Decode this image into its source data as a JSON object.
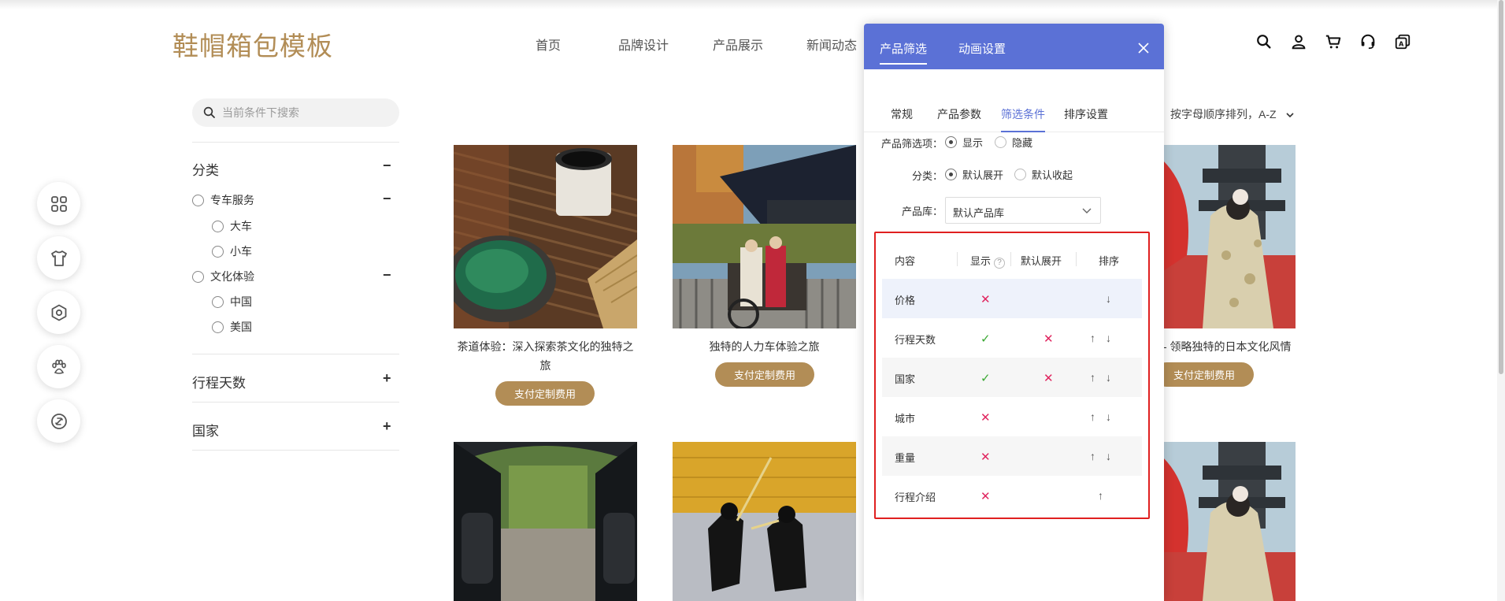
{
  "site": {
    "logo": "鞋帽箱包模板"
  },
  "nav": [
    "首页",
    "品牌设计",
    "产品展示",
    "新闻动态"
  ],
  "header_icons": [
    "search-icon",
    "user-icon",
    "cart-icon",
    "headset-icon",
    "translate-icon"
  ],
  "float_icons": [
    "apps-icon",
    "tshirt-icon",
    "settings-icon",
    "paw-icon",
    "link-icon"
  ],
  "sidebar": {
    "search_placeholder": "当前条件下搜索",
    "category": {
      "title": "分类",
      "toggle": "−",
      "groups": [
        {
          "label": "专车服务",
          "toggle": "−",
          "items": [
            "大车",
            "小车"
          ]
        },
        {
          "label": "文化体验",
          "toggle": "−",
          "items": [
            "中国",
            "美国"
          ]
        }
      ]
    },
    "sections": [
      {
        "title": "行程天数",
        "toggle": "+"
      },
      {
        "title": "国家",
        "toggle": "+"
      }
    ]
  },
  "sort": {
    "label": "按字母顺序排列，A-Z"
  },
  "products": [
    {
      "name_line1": "茶道体验：深入探索茶文化的独特之",
      "name_line2": "旅",
      "button": "支付定制费用"
    },
    {
      "name_line1": "独特的人力车体验之旅",
      "name_line2": "",
      "button": "支付定制费用"
    },
    {
      "name_line1": "- 领略独特的日本文化风情",
      "name_line2": "",
      "button": "支付定制费用"
    }
  ],
  "panel": {
    "tabs": [
      "产品筛选",
      "动画设置"
    ],
    "subtabs": [
      "常规",
      "产品参数",
      "筛选条件",
      "排序设置"
    ],
    "active_subtab": "筛选条件",
    "options": {
      "filter_label": "产品筛选项：",
      "filter_show": "显示",
      "filter_hide": "隐藏",
      "category_label": "分类：",
      "category_expand": "默认展开",
      "category_collapse": "默认收起",
      "library_label": "产品库：",
      "library_value": "默认产品库"
    },
    "table": {
      "headers": {
        "content": "内容",
        "show": "显示",
        "expand": "默认展开",
        "order": "排序"
      },
      "rows": [
        {
          "name": "价格",
          "show": "✕",
          "expand": "",
          "up": "",
          "down": "↓"
        },
        {
          "name": "行程天数",
          "show": "✓",
          "expand": "✕",
          "up": "↑",
          "down": "↓"
        },
        {
          "name": "国家",
          "show": "✓",
          "expand": "✕",
          "up": "↑",
          "down": "↓"
        },
        {
          "name": "城市",
          "show": "✕",
          "expand": "",
          "up": "↑",
          "down": "↓"
        },
        {
          "name": "重量",
          "show": "✕",
          "expand": "",
          "up": "↑",
          "down": "↓"
        },
        {
          "name": "行程介绍",
          "show": "✕",
          "expand": "",
          "up": "↑",
          "down": ""
        }
      ]
    }
  }
}
